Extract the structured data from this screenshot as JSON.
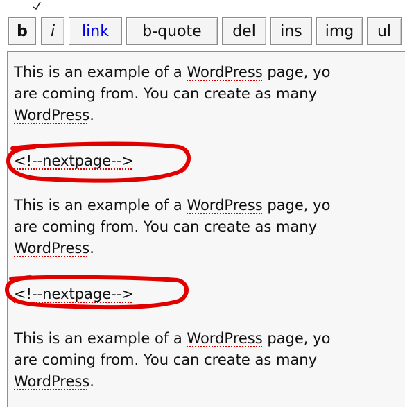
{
  "toolbar": {
    "buttons": [
      {
        "key": "bold",
        "label": "b"
      },
      {
        "key": "italic",
        "label": "i"
      },
      {
        "key": "link",
        "label": "link"
      },
      {
        "key": "blockquote",
        "label": "b-quote"
      },
      {
        "key": "del",
        "label": "del"
      },
      {
        "key": "ins",
        "label": "ins"
      },
      {
        "key": "img",
        "label": "img"
      },
      {
        "key": "ul",
        "label": "ul"
      }
    ]
  },
  "editor": {
    "paragraphs": [
      {
        "line1_prefix": "This is an example of a ",
        "line1_word": "WordPress",
        "line1_suffix": " page, yo",
        "line2": "are coming from. You can create as many",
        "line3_word": "WordPress",
        "line3_suffix": "."
      },
      {
        "line1_prefix": "This is an example of a ",
        "line1_word": "WordPress",
        "line1_suffix": " page, yo",
        "line2": "are coming from. You can create as many",
        "line3_word": "WordPress",
        "line3_suffix": "."
      },
      {
        "line1_prefix": "This is an example of a ",
        "line1_word": "WordPress",
        "line1_suffix": " page, yo",
        "line2": "are coming from. You can create as many",
        "line3_word": "WordPress",
        "line3_suffix": "."
      }
    ],
    "nextpage_tags": [
      {
        "text": "<!--nextpage-->"
      },
      {
        "text": "<!--nextpage-->"
      }
    ]
  },
  "colors": {
    "highlight_circle": "#e00000",
    "spellcheck_underline": "#d40000",
    "link_label": "#0000ee"
  }
}
